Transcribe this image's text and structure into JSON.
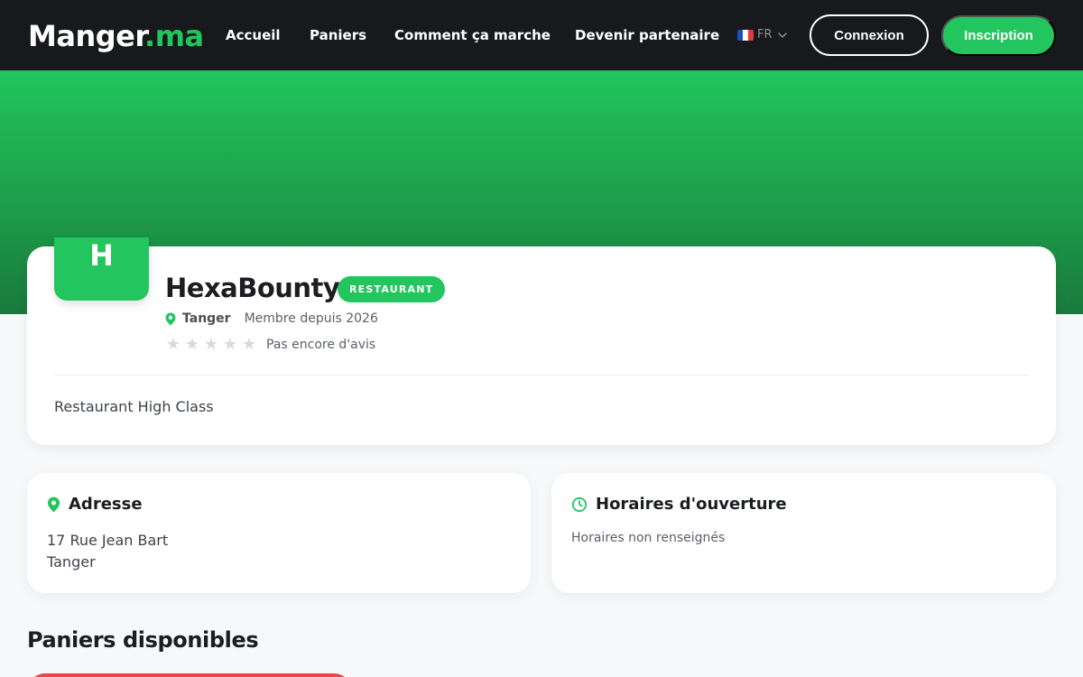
{
  "nav": {
    "logo_main": "Manger",
    "logo_accent": ".ma",
    "links": [
      "Accueil",
      "Paniers",
      "Comment ça marche",
      "Devenir partenaire"
    ],
    "language": "FR",
    "login_label": "Connexion",
    "signup_label": "Inscription"
  },
  "profile": {
    "avatar_letter": "H",
    "name": "HexaBounty",
    "category_badge": "RESTAURANT",
    "city": "Tanger",
    "member_since": "Membre depuis 2026",
    "rating_stars": 0,
    "rating_text": "Pas encore d'avis",
    "description": "Restaurant High Class"
  },
  "address_card": {
    "title": "Adresse",
    "line1": "17 Rue Jean Bart",
    "line2": "Tanger"
  },
  "hours_card": {
    "title": "Horaires d'ouverture",
    "text": "Horaires non renseignés"
  },
  "baskets": {
    "title": "Paniers disponibles"
  },
  "colors": {
    "brand_green": "#22c55e",
    "nav_bg": "#17191c",
    "basket_accent": "#ef4444"
  }
}
